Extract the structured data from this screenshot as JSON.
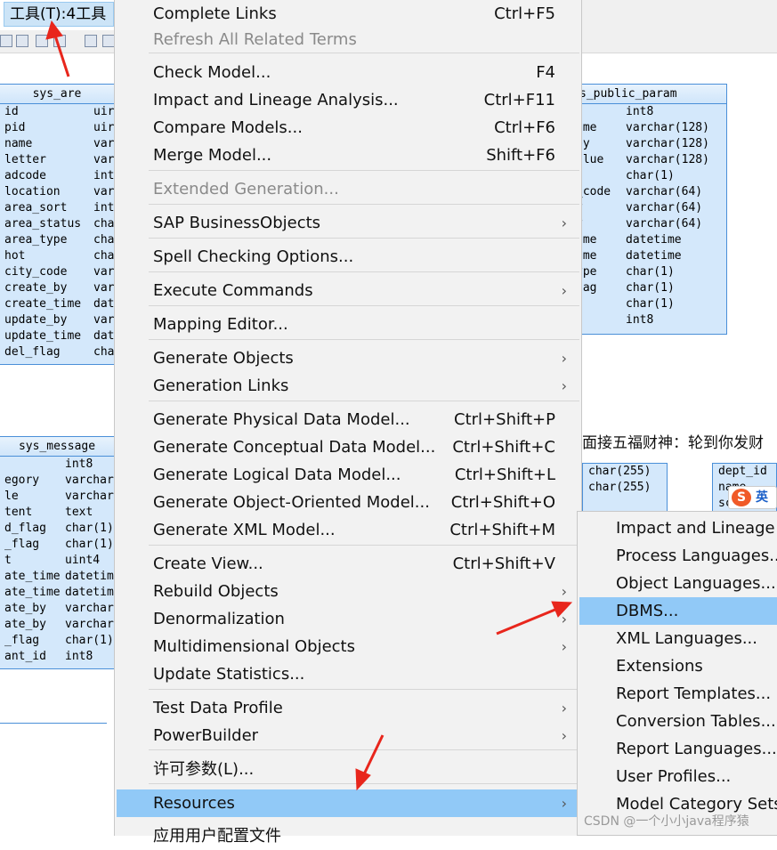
{
  "menubar": {
    "tools_label": "工具(T):4工具"
  },
  "tables": {
    "sys_area": {
      "title": "sys_are",
      "rows": [
        [
          "id",
          "uir"
        ],
        [
          "pid",
          "uir"
        ],
        [
          "name",
          "var"
        ],
        [
          "letter",
          "var"
        ],
        [
          "adcode",
          "int"
        ],
        [
          "location",
          "var"
        ],
        [
          "area_sort",
          "int"
        ],
        [
          "area_status",
          "cha"
        ],
        [
          "area_type",
          "cha"
        ],
        [
          "hot",
          "cha"
        ],
        [
          "city_code",
          "var"
        ],
        [
          "create_by",
          "var"
        ],
        [
          "create_time",
          "dat"
        ],
        [
          "update_by",
          "var"
        ],
        [
          "update_time",
          "dat"
        ],
        [
          "del_flag",
          "cha"
        ]
      ]
    },
    "sys_public_param": {
      "title": "s_public_param",
      "rows": [
        [
          "d",
          "int8"
        ],
        [
          "ame",
          "varchar(128)"
        ],
        [
          "ey",
          "varchar(128)"
        ],
        [
          "alue",
          "varchar(128)"
        ],
        [
          "",
          "char(1)"
        ],
        [
          "_code",
          "varchar(64)"
        ],
        [
          "y",
          "varchar(64)"
        ],
        [
          "y",
          "varchar(64)"
        ],
        [
          "ime",
          "datetime"
        ],
        [
          "ime",
          "datetime"
        ],
        [
          "ype",
          "char(1)"
        ],
        [
          "lag",
          "char(1)"
        ],
        [
          "",
          "char(1)"
        ],
        [
          "d",
          "int8"
        ]
      ]
    },
    "sys_message": {
      "title": "sys_message",
      "rows": [
        [
          "",
          "int8"
        ],
        [
          "egory",
          "varchar"
        ],
        [
          "le",
          "varchar"
        ],
        [
          "tent",
          "text"
        ],
        [
          "d_flag",
          "char(1)"
        ],
        [
          "_flag",
          "char(1)"
        ],
        [
          "t",
          "uint4"
        ],
        [
          "ate_time",
          "datetim"
        ],
        [
          "ate_time",
          "datetim"
        ],
        [
          "ate_by",
          "varchar"
        ],
        [
          "ate_by",
          "varchar"
        ],
        [
          "_flag",
          "char(1)"
        ],
        [
          "ant_id",
          "int8"
        ]
      ]
    }
  },
  "background": {
    "banner_text": "面接五福财神：轮到你发财",
    "mini1_rows": [
      "char(255)",
      "char(255)"
    ],
    "mini2_rows": [
      "dept_id",
      "name",
      "sc"
    ],
    "ime_icon": "sogou-ime-icon",
    "ime_s": "S",
    "ime_en": "英"
  },
  "main_menu": {
    "items": [
      {
        "label": "Complete Links",
        "shortcut": "Ctrl+F5"
      },
      {
        "label": "Refresh All Related Terms",
        "shortcut": "",
        "disabled": true
      },
      {
        "label": "Check Model...",
        "shortcut": "F4"
      },
      {
        "label": "Impact and Lineage Analysis...",
        "shortcut": "Ctrl+F11"
      },
      {
        "label": "Compare Models...",
        "shortcut": "Ctrl+F6"
      },
      {
        "label": "Merge Model...",
        "shortcut": "Shift+F6"
      },
      {
        "label": "Extended Generation...",
        "shortcut": "",
        "disabled": true
      },
      {
        "label": "SAP BusinessObjects",
        "shortcut": ""
      },
      {
        "label": "Spell Checking Options...",
        "shortcut": ""
      },
      {
        "label": "Execute Commands",
        "shortcut": ""
      },
      {
        "label": "Mapping Editor...",
        "shortcut": ""
      },
      {
        "label": "Generate Objects",
        "shortcut": ""
      },
      {
        "label": "Generation Links",
        "shortcut": ""
      },
      {
        "label": "Generate Physical Data Model...",
        "shortcut": "Ctrl+Shift+P"
      },
      {
        "label": "Generate Conceptual Data Model...",
        "shortcut": "Ctrl+Shift+C"
      },
      {
        "label": "Generate Logical Data Model...",
        "shortcut": "Ctrl+Shift+L"
      },
      {
        "label": "Generate Object-Oriented Model...",
        "shortcut": "Ctrl+Shift+O"
      },
      {
        "label": "Generate XML Model...",
        "shortcut": "Ctrl+Shift+M"
      },
      {
        "label": "Create View...",
        "shortcut": "Ctrl+Shift+V"
      },
      {
        "label": "Rebuild Objects",
        "shortcut": ""
      },
      {
        "label": "Denormalization",
        "shortcut": ""
      },
      {
        "label": "Multidimensional Objects",
        "shortcut": ""
      },
      {
        "label": "Update Statistics...",
        "shortcut": ""
      },
      {
        "label": "Test Data Profile",
        "shortcut": ""
      },
      {
        "label": "PowerBuilder",
        "shortcut": ""
      },
      {
        "label": "许可参数(L)...",
        "shortcut": ""
      },
      {
        "label": "Resources",
        "shortcut": "",
        "selected": true
      },
      {
        "label": "应用用户配置文件",
        "shortcut": ""
      }
    ],
    "arrow_glyph": "›"
  },
  "sub_menu": {
    "items": [
      {
        "label": "Impact and Lineage A"
      },
      {
        "label": "Process Languages..."
      },
      {
        "label": "Object Languages..."
      },
      {
        "label": "DBMS...",
        "selected": true
      },
      {
        "label": "XML Languages..."
      },
      {
        "label": "Extensions"
      },
      {
        "label": "Report Templates..."
      },
      {
        "label": "Conversion Tables..."
      },
      {
        "label": "Report Languages..."
      },
      {
        "label": "User Profiles..."
      },
      {
        "label": "Model Category Sets..."
      }
    ]
  },
  "watermark": "CSDN @一个小小java程序猿",
  "colors": {
    "menu_bg": "#f2f2f2",
    "selection": "#91c9f7",
    "table_bg": "#d4e8fb",
    "annotation_arrow": "#e8261c"
  }
}
